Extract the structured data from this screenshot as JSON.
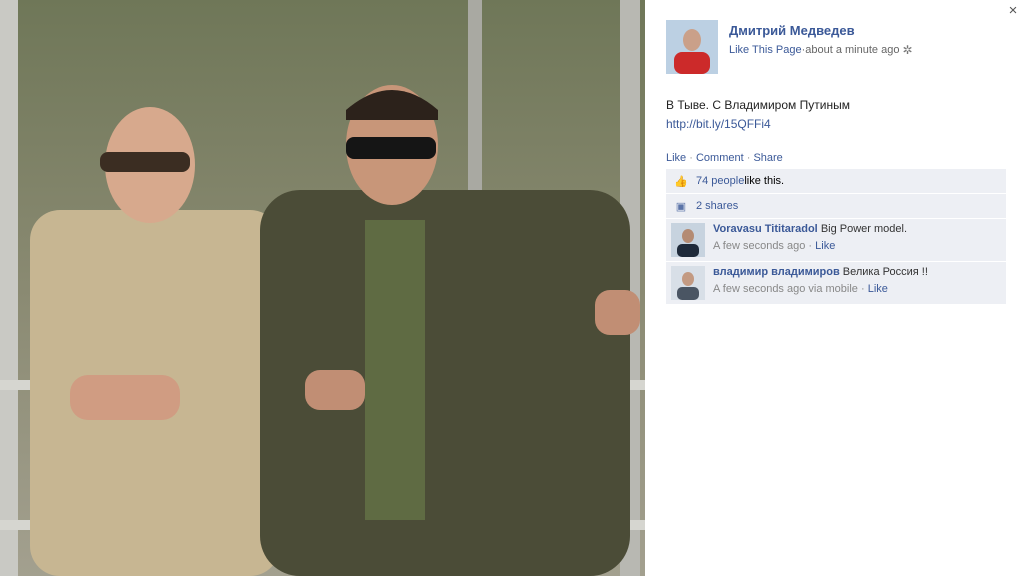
{
  "photo": {
    "alt_description_icon": "photo"
  },
  "close": {
    "label": "×"
  },
  "post": {
    "author": "Дмитрий Медведев",
    "like_page": "Like This Page",
    "separator": " · ",
    "timestamp": "about a minute ago",
    "message": "В Тыве. С Владимиром Путиным",
    "link": "http://bit.ly/15QFFi4",
    "actions": {
      "like": "Like",
      "comment": "Comment",
      "share": "Share",
      "dot": " · "
    },
    "likes_count": "74 people",
    "likes_suffix": " like this.",
    "shares": "2 shares"
  },
  "comments": [
    {
      "name": "Voravasu Tititaradol",
      "text": "Big Power model.",
      "time": "A few seconds ago",
      "via": "",
      "like": "Like"
    },
    {
      "name": "владимир владимиров",
      "text": "Велика Россия !!",
      "time": "A few seconds ago",
      "via": " via mobile",
      "like": "Like"
    }
  ],
  "colors": {
    "link": "#3b5998",
    "panel": "#edeff4"
  }
}
